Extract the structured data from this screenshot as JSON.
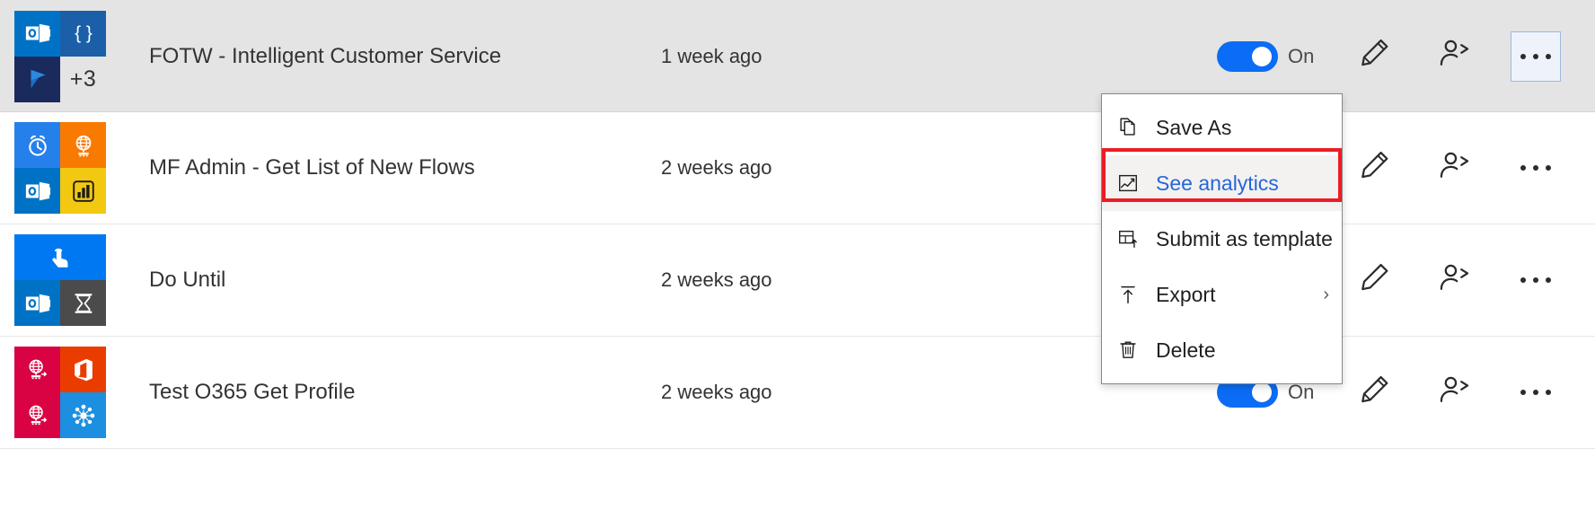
{
  "theme": {
    "accent_blue": "#0b6cf5",
    "link_blue": "#2766d8",
    "highlight_red": "#ec1c24",
    "selected_row_bg": "#e4e4e4",
    "menu_hover_bg": "#f3f2f1"
  },
  "rows": [
    {
      "name": "FOTW - Intelligent Customer Service",
      "modified": "1 week ago",
      "toggle_state": "On",
      "toggle_label": "On",
      "selected": true,
      "more_count": "+3",
      "connectors": [
        {
          "icon": "outlook-icon",
          "color": "#0072c6"
        },
        {
          "icon": "braces-json-icon",
          "color": "#1b5fa8"
        },
        {
          "icon": "dynamics365-icon",
          "color": "#1b2a5c"
        }
      ],
      "actions": [
        "edit-icon",
        "share-icon",
        "more-options-icon"
      ]
    },
    {
      "name": "MF Admin - Get List of New Flows",
      "modified": "2 weeks ago",
      "toggle_state": "On",
      "toggle_label": "",
      "selected": false,
      "more_count": "",
      "connectors": [
        {
          "icon": "recurrence-clock-icon",
          "color": "#2680eb"
        },
        {
          "icon": "rss-globe-icon",
          "color": "#f97a00"
        },
        {
          "icon": "outlook-icon",
          "color": "#0072c6"
        },
        {
          "icon": "power-bi-icon",
          "color": "#f2c811"
        }
      ],
      "actions": [
        "edit-icon",
        "share-icon",
        "more-options-icon"
      ]
    },
    {
      "name": "Do Until",
      "modified": "2 weeks ago",
      "toggle_state": "On",
      "toggle_label": "",
      "selected": false,
      "more_count": "",
      "connectors": [
        {
          "icon": "button-tap-icon",
          "color": "#0078f2"
        },
        {
          "icon": "outlook-icon",
          "color": "#0072c6"
        },
        {
          "icon": "hourglass-delay-icon",
          "color": "#4b4b4b"
        }
      ],
      "actions": [
        "edit-icon",
        "share-icon",
        "more-options-icon"
      ]
    },
    {
      "name": "Test O365 Get Profile",
      "modified": "2 weeks ago",
      "toggle_state": "On",
      "toggle_label": "On",
      "selected": false,
      "more_count": "",
      "connectors": [
        {
          "icon": "http-globe-icon",
          "color": "#d90343"
        },
        {
          "icon": "office365-icon",
          "color": "#eb3c00"
        },
        {
          "icon": "http-globe-icon",
          "color": "#d90343"
        },
        {
          "icon": "office365-users-icon",
          "color": "#1c8fe0"
        }
      ],
      "actions": [
        "edit-icon",
        "share-icon",
        "more-options-icon"
      ]
    }
  ],
  "context_menu": {
    "items": [
      {
        "label": "Save As",
        "icon": "copy-page-icon",
        "highlighted": false,
        "submenu": false
      },
      {
        "label": "See analytics",
        "icon": "analytics-chart-icon",
        "highlighted": true,
        "submenu": false
      },
      {
        "label": "Submit as template",
        "icon": "submit-template-icon",
        "highlighted": false,
        "submenu": false
      },
      {
        "label": "Export",
        "icon": "export-arrow-up-icon",
        "highlighted": false,
        "submenu": true
      },
      {
        "label": "Delete",
        "icon": "trash-delete-icon",
        "highlighted": false,
        "submenu": false
      }
    ],
    "submenu_chevron": "›"
  }
}
